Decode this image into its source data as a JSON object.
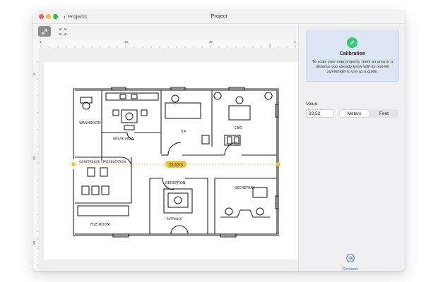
{
  "window": {
    "title": "Project",
    "back_label": "Projects"
  },
  "toolbar": {
    "tools": [
      {
        "icon": "diagonal-arrows-icon",
        "active": true
      },
      {
        "icon": "crop-frame-icon",
        "active": false
      }
    ]
  },
  "ruler": {
    "top_marks": [
      "0",
      "10",
      "20",
      "3"
    ],
    "left_marks": [
      "0",
      "10",
      "20"
    ]
  },
  "floorplan": {
    "measurement": "23,52m",
    "room_labels": {
      "washroom": "WASHROOM",
      "break_area": "BREAK AREA",
      "vp": "V.P",
      "ceo": "CEO",
      "conference": "CONFERENCE / PRESENTATION",
      "reception": "RECEPTION",
      "secretary": "SECRETARY",
      "file_room": "FILE ROOM",
      "entrance": "ENTRANCE"
    }
  },
  "sidebar": {
    "calibration_title": "Calibration",
    "calibration_text": "To scale your map properly, mark an area or a distance you already know with its real-life size/length to use as a guide.",
    "value_label": "Value",
    "value": "23,52",
    "unit_options": [
      "Meters",
      "Feet"
    ],
    "selected_unit": "Meters",
    "continue_label": "Continue"
  },
  "colors": {
    "accent": "#3d7bd4",
    "check_green": "#2ecc71",
    "calibration_line": "#f2c230"
  }
}
